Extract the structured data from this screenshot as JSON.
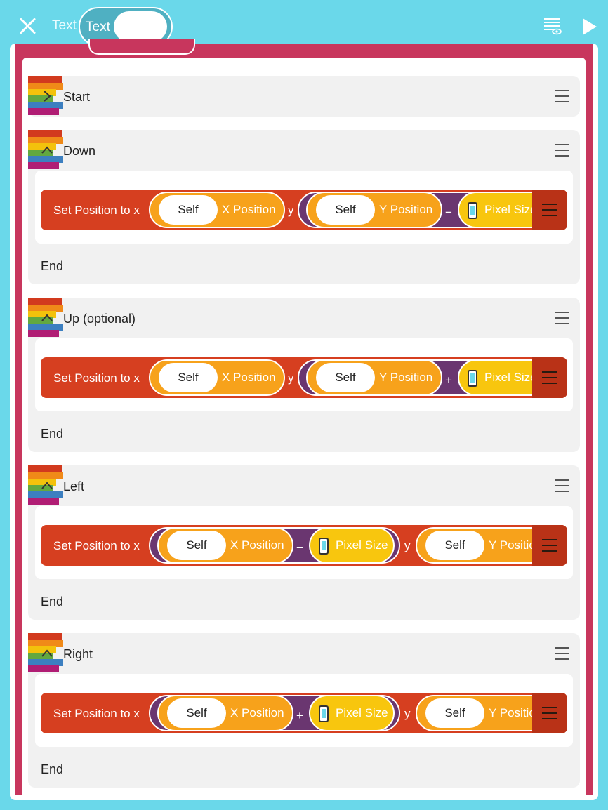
{
  "toolbar": {
    "mode_label": "Text",
    "toggle_label": "Text"
  },
  "scripts": [
    {
      "title": "Start"
    },
    {
      "title": "Down",
      "end": "End",
      "block": {
        "label": "Set Position to x",
        "self": "Self",
        "x_attr": "X Position",
        "y_label": "y",
        "y_attr": "Y Position",
        "op": "−",
        "pixel": "Pixel Size"
      }
    },
    {
      "title": "Up (optional)",
      "end": "End",
      "block": {
        "label": "Set Position to x",
        "self": "Self",
        "x_attr": "X Position",
        "y_label": "y",
        "y_attr": "Y Position",
        "op": "+",
        "pixel": "Pixel Size"
      }
    },
    {
      "title": "Left",
      "end": "End",
      "block": {
        "label": "Set Position to x",
        "self": "Self",
        "x_attr": "X Position",
        "y_label": "y",
        "y_attr": "Y Position",
        "op": "−",
        "pixel": "Pixel Size"
      }
    },
    {
      "title": "Right",
      "end": "End",
      "block": {
        "label": "Set Position to x",
        "self": "Self",
        "x_attr": "X Position",
        "y_label": "y",
        "y_attr": "Y Position",
        "op": "+",
        "pixel": "Pixel Size"
      }
    }
  ],
  "colors": {
    "frame": "#c8365d",
    "block": "#d63f20",
    "purple": "#6a3670",
    "orange": "#f7a21b",
    "yellow": "#f8c60e",
    "cyan": "#6ad8ea"
  }
}
